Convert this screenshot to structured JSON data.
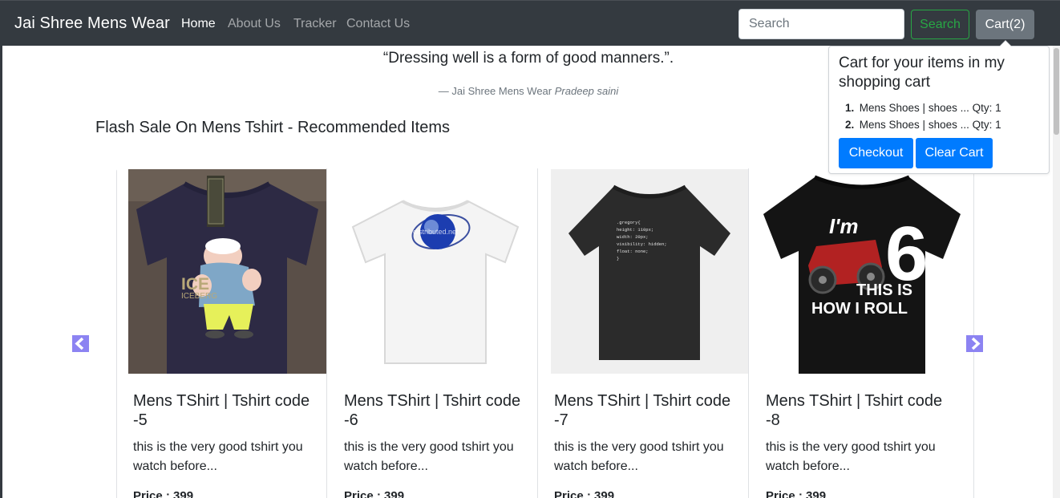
{
  "navbar": {
    "brand": "Jai Shree Mens Wear",
    "links": [
      "Home",
      "About Us",
      "Tracker",
      "Contact Us"
    ],
    "search_placeholder": "Search",
    "search_button": "Search",
    "cart_button": "Cart(2)"
  },
  "quote": {
    "text": "“Dressing well is a form of good manners.”.",
    "footer_prefix": "— Jai Shree Mens Wear",
    "footer_author": "Pradeep saini"
  },
  "section_title": "Flash Sale On Mens Tshirt - Recommended Items",
  "products": [
    {
      "title": "Mens TShirt | Tshirt code -5",
      "description": "this is the very good tshirt you watch before...",
      "price": "Price : 399",
      "image": "navy tshirt with cartoon sailor print"
    },
    {
      "title": "Mens TShirt | Tshirt code -6",
      "description": "this is the very good tshirt you watch before...",
      "price": "Price : 399",
      "image": "white tshirt with globe print"
    },
    {
      "title": "Mens TShirt | Tshirt code -7",
      "description": "this is the very good tshirt you watch before...",
      "price": "Price : 399",
      "image": "black tshirt with css code print"
    },
    {
      "title": "Mens TShirt | Tshirt code -8",
      "description": "this is the very good tshirt you watch before...",
      "price": "Price : 399",
      "image": "black tshirt with monster truck print"
    }
  ],
  "tshirt_prints": {
    "ice": "ICE",
    "iceberg": "ICEBERG",
    "globe_text": "distributed.net",
    "code_lines": [
      ".gregory{",
      "  height: 110px;",
      "  width: 20px;",
      "  visibility: hidden;",
      "  float: none;",
      "}"
    ],
    "im": "I'm",
    "six": "6",
    "roll_1": "THIS IS",
    "roll_2": "HOW I ROLL"
  },
  "cart_popover": {
    "title": "Cart for your items in my shopping cart",
    "items": [
      {
        "num": "1.",
        "text": "Mens Shoes | shoes ... Qty: 1"
      },
      {
        "num": "2.",
        "text": "Mens Shoes | shoes ... Qty: 1"
      }
    ],
    "checkout": "Checkout",
    "clear_cart": "Clear Cart"
  },
  "colors": {
    "navbar_bg": "#343a40",
    "success": "#28a745",
    "secondary": "#6c757d",
    "primary": "#007bff",
    "carousel_arrow": "#8c83f2"
  },
  "icons": {
    "prev": "chevron-left-icon",
    "next": "chevron-right-icon"
  }
}
